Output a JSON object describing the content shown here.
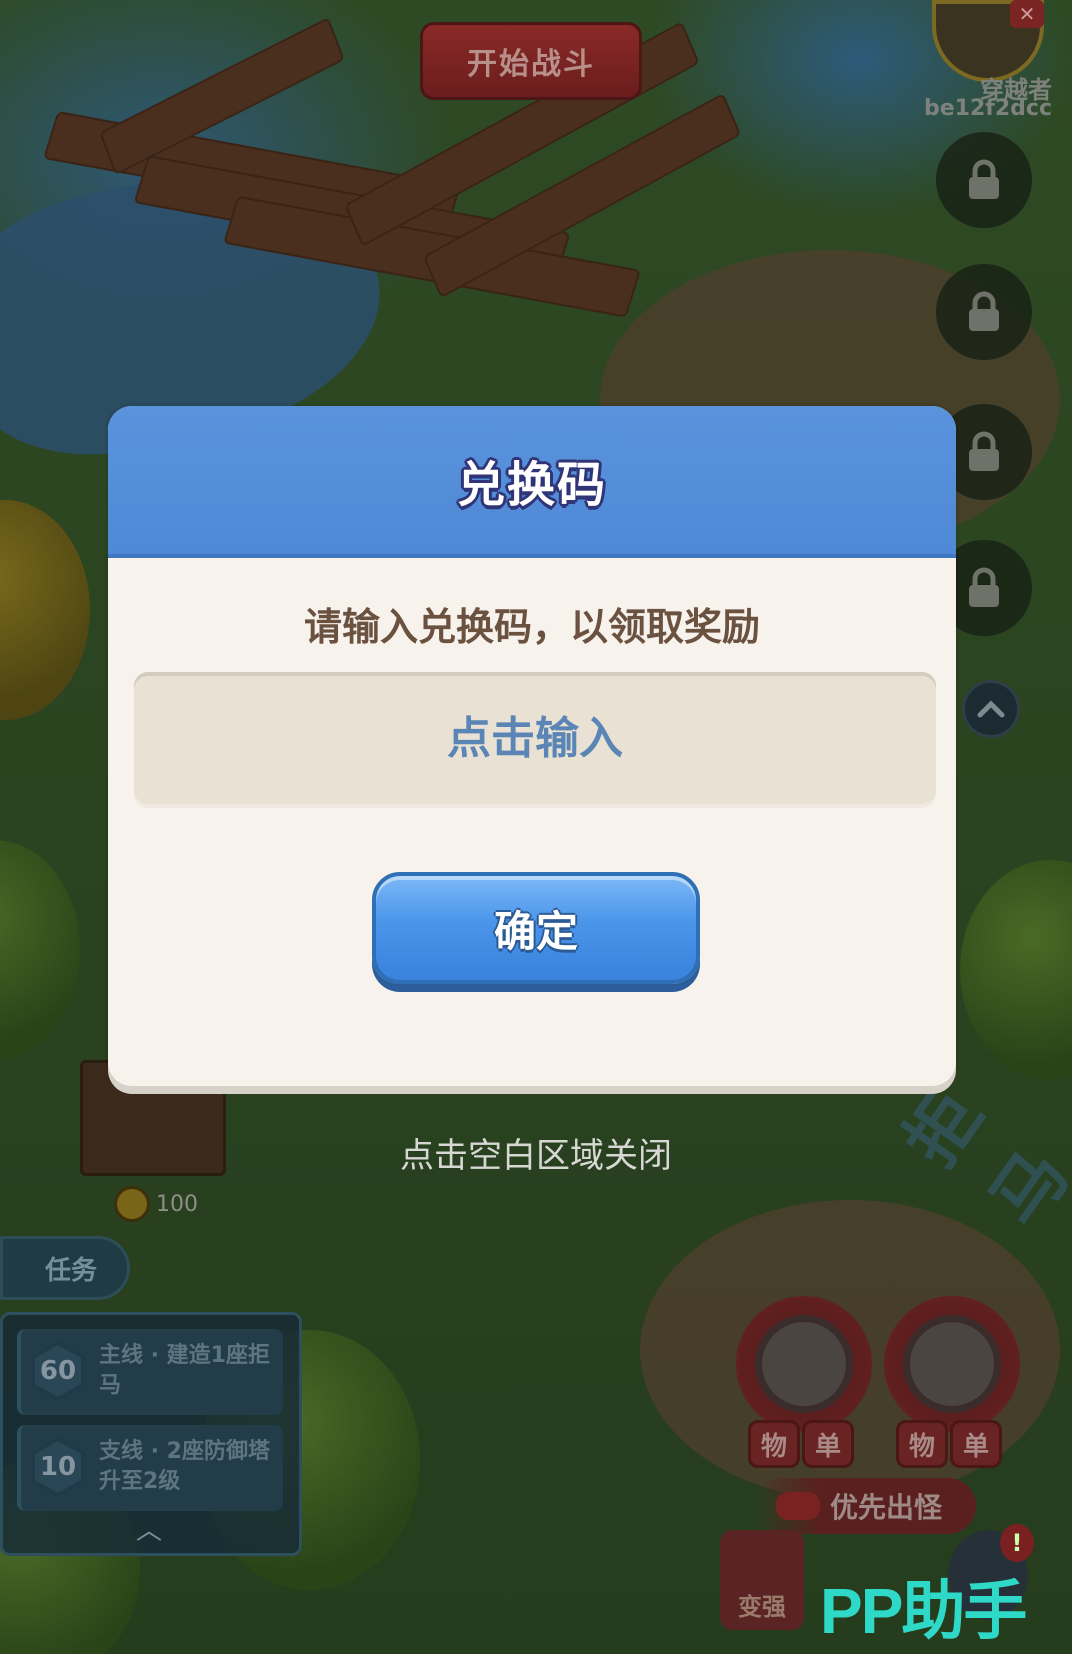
{
  "top": {
    "start_battle": "开始战斗",
    "player_name": "穿越者",
    "player_id": "be12f2dcc"
  },
  "hud": {
    "coin_value": "100",
    "task_tab": "任务",
    "quests": [
      {
        "level": "60",
        "text": "主线 · 建造1座拒马"
      },
      {
        "level": "10",
        "text": "支线 · 2座防御塔升至2级"
      }
    ],
    "hero_tags": [
      "物",
      "单",
      "物",
      "单"
    ],
    "priority_label": "优先出怪",
    "strong_label": "变强",
    "watermark": "PP助手",
    "road_text": "拒马"
  },
  "dialog": {
    "title": "兑换码",
    "subtitle": "请输入兑换码，以领取奖励",
    "input_value": "",
    "input_placeholder": "点击输入",
    "confirm_label": "确定"
  },
  "close_hint": "点击空白区域关闭"
}
